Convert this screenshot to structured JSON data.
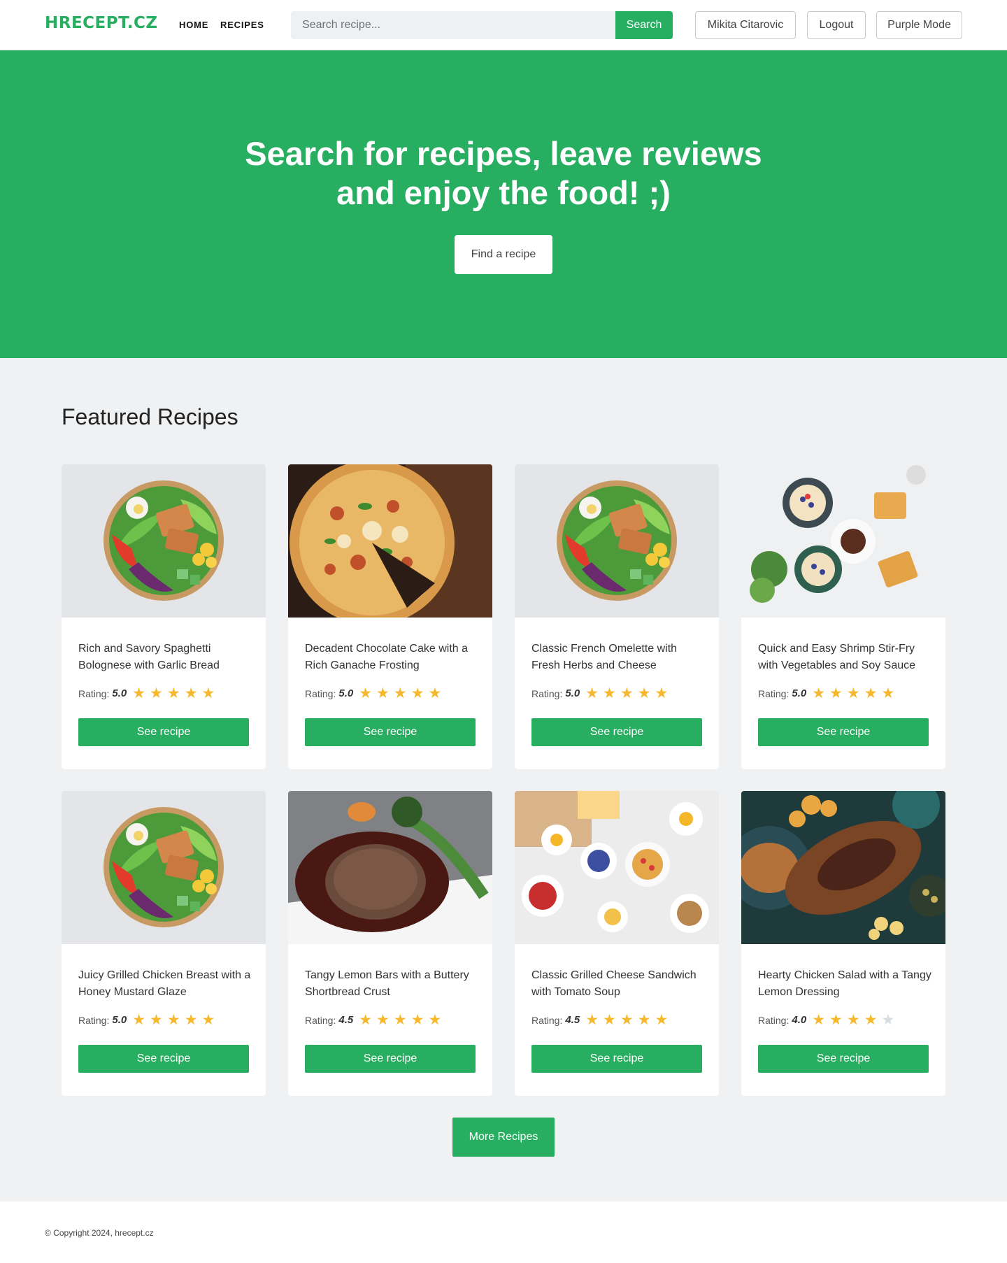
{
  "header": {
    "logo": "HRECEPT.CZ",
    "nav": {
      "home": "HOME",
      "recipes": "RECIPES"
    },
    "search": {
      "placeholder": "Search recipe...",
      "button": "Search"
    },
    "user_button": "Mikita Citarovic",
    "logout_button": "Logout",
    "theme_button": "Purple Mode"
  },
  "hero": {
    "title_line1": "Search for recipes, leave reviews",
    "title_line2": "and enjoy the food! ;)",
    "button": "Find a recipe"
  },
  "featured": {
    "title": "Featured Recipes",
    "rating_label": "Rating:",
    "card_button": "See recipe",
    "cards": [
      {
        "title": "Rich and Savory Spaghetti Bolognese with Garlic Bread",
        "rating": "5.0",
        "stars": 5,
        "image": "salad-bowl"
      },
      {
        "title": "Decadent Chocolate Cake with a Rich Ganache Frosting",
        "rating": "5.0",
        "stars": 5,
        "image": "pizza"
      },
      {
        "title": "Classic French Omelette with Fresh Herbs and Cheese",
        "rating": "5.0",
        "stars": 5,
        "image": "salad-bowl"
      },
      {
        "title": "Quick and Easy Shrimp Stir-Fry with Vegetables and Soy Sauce",
        "rating": "5.0",
        "stars": 5,
        "image": "brunch-table"
      },
      {
        "title": "Juicy Grilled Chicken Breast with a Honey Mustard Glaze",
        "rating": "5.0",
        "stars": 5,
        "image": "salad-bowl"
      },
      {
        "title": "Tangy Lemon Bars with a Buttery Shortbread Crust",
        "rating": "4.5",
        "stars": 4.5,
        "image": "steak"
      },
      {
        "title": "Classic Grilled Cheese Sandwich with Tomato Soup",
        "rating": "4.5",
        "stars": 4.5,
        "image": "breakfast-spread"
      },
      {
        "title": "Hearty Chicken Salad with a Tangy Lemon Dressing",
        "rating": "4.0",
        "stars": 4,
        "image": "roast-dinner"
      }
    ],
    "more_button": "More Recipes"
  },
  "footer": {
    "copyright": "© Copyright 2024, hrecept.cz"
  },
  "colors": {
    "brand": "#27ae60",
    "star": "#f5b82e",
    "star_off": "#d9dcdf"
  }
}
